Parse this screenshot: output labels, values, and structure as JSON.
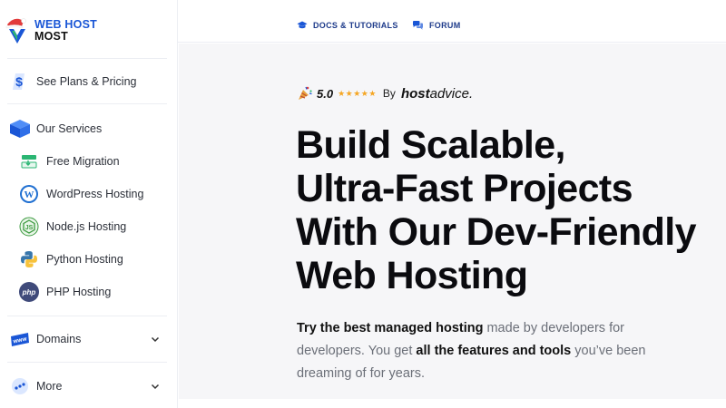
{
  "logo": {
    "line1": "WEB HOST",
    "line2": "MOST"
  },
  "topbar": {
    "docs_label": "DOCS & TUTORIALS",
    "forum_label": "FORUM"
  },
  "sidebar": {
    "plans_label": "See Plans & Pricing",
    "services_label": "Our Services",
    "services": [
      {
        "label": "Free Migration",
        "icon": "migration-icon"
      },
      {
        "label": "WordPress Hosting",
        "icon": "wordpress-icon"
      },
      {
        "label": "Node.js Hosting",
        "icon": "nodejs-icon"
      },
      {
        "label": "Python Hosting",
        "icon": "python-icon"
      },
      {
        "label": "PHP Hosting",
        "icon": "php-icon"
      }
    ],
    "domains_label": "Domains",
    "more_label": "More"
  },
  "hero": {
    "rating_score": "5.0",
    "stars": "★★★★★",
    "rating_by": "By",
    "brand_bold": "host",
    "brand_thin": "advice.",
    "headline": [
      "Build Scalable,",
      "Ultra-Fast Projects",
      "With Our Dev-Friendly",
      "Web Hosting"
    ],
    "sub_part1": "Try the best managed hosting",
    "sub_part2": " made by developers for developers. You get ",
    "sub_part3": "all the features and tools",
    "sub_part4": " you’ve been dreaming of for years."
  },
  "colors": {
    "accent": "#1a56d6",
    "star": "#f5a623",
    "text_muted": "#6b6f78"
  }
}
